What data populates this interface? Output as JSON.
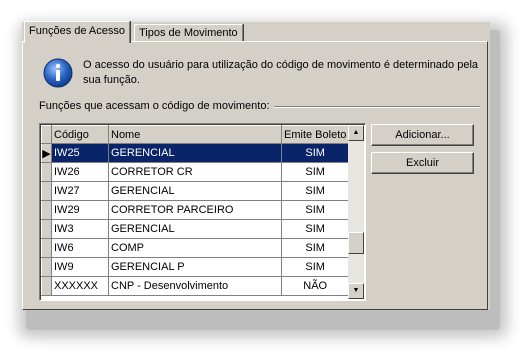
{
  "tabs": [
    {
      "label": "Funções de Acesso",
      "active": true
    },
    {
      "label": "Tipos de Movimento",
      "active": false
    }
  ],
  "info": {
    "icon": "info-icon",
    "text": "O acesso do usuário para utilização do código de movimento é determinado pela sua função."
  },
  "group_label": "Funções que acessam o código de movimento:",
  "grid": {
    "columns": [
      "Código",
      "Nome",
      "Emite Boleto"
    ],
    "rows": [
      {
        "codigo": "IW25",
        "nome": "GERENCIAL",
        "emite": "SIM",
        "selected": true
      },
      {
        "codigo": "IW26",
        "nome": "CORRETOR CR",
        "emite": "SIM"
      },
      {
        "codigo": "IW27",
        "nome": "GERENCIAL",
        "emite": "SIM"
      },
      {
        "codigo": "IW29",
        "nome": "CORRETOR PARCEIRO",
        "emite": "SIM"
      },
      {
        "codigo": "IW3",
        "nome": "GERENCIAL",
        "emite": "SIM"
      },
      {
        "codigo": "IW6",
        "nome": "COMP",
        "emite": "SIM"
      },
      {
        "codigo": "IW9",
        "nome": "GERENCIAL P",
        "emite": "SIM"
      },
      {
        "codigo": "XXXXXX",
        "nome": "CNP - Desenvolvimento",
        "emite": "NÃO"
      }
    ]
  },
  "buttons": {
    "add": "Adicionar...",
    "delete": "Excluir"
  },
  "colors": {
    "panel": "#d4d0c8",
    "selection": "#0a246a",
    "info_blue": "#2a64c4"
  }
}
